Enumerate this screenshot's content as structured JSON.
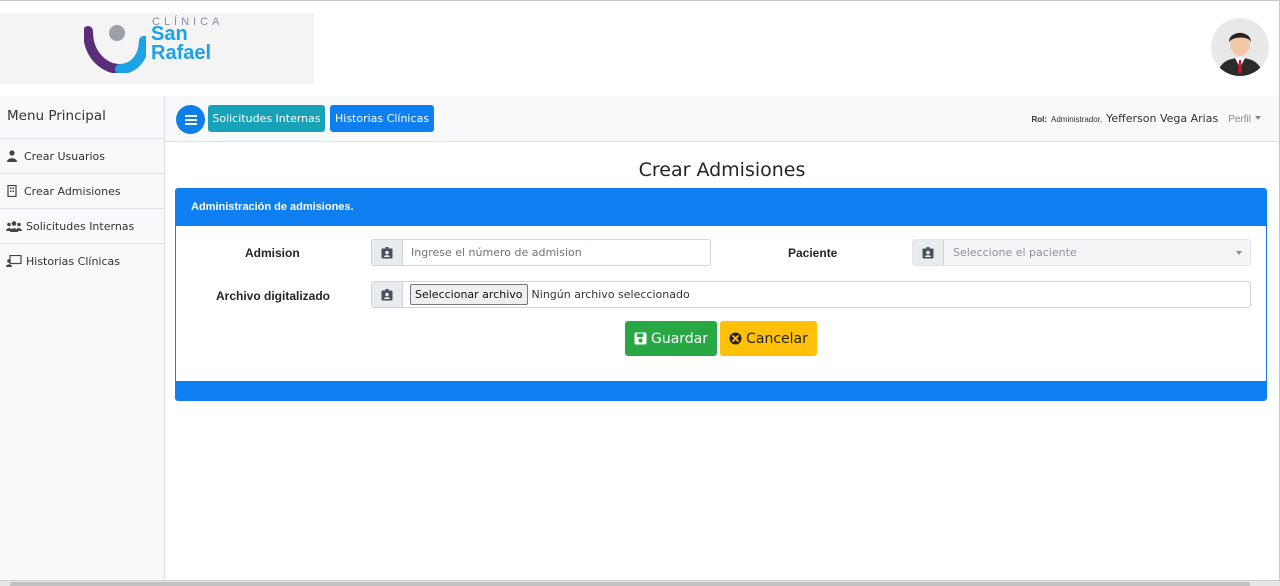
{
  "logo": {
    "small_text": "CLÍNICA",
    "line1": "San",
    "line2": "Rafael"
  },
  "sidebar": {
    "title": "Menu Principal",
    "items": [
      {
        "label": "Crear Usuarios",
        "icon": "user-tie-icon"
      },
      {
        "label": "Crear Admisiones",
        "icon": "building-icon"
      },
      {
        "label": "Solicitudes Internas",
        "icon": "users-icon"
      },
      {
        "label": "Historias Clínicas",
        "icon": "chalkboard-user-icon"
      }
    ]
  },
  "navbar": {
    "btn_solicitudes": "Solicitudes Internas",
    "btn_historias": "Historias Clínicas",
    "rol_label": "Rol:",
    "rol_value": "Administrador,",
    "user_name": "Yefferson Vega Arias",
    "perfil": "Perfil"
  },
  "page": {
    "title": "Crear Admisiones"
  },
  "card": {
    "header": "Administración de admisiones.",
    "admision_label": "Admision",
    "admision_placeholder": "Ingrese el número de admision",
    "paciente_label": "Paciente",
    "paciente_placeholder": "Seleccione el paciente",
    "archivo_label": "Archivo digitalizado",
    "file_button": "Seleccionar archivo",
    "file_status": "Ningún archivo seleccionado",
    "guardar": "Guardar",
    "cancelar": "Cancelar"
  },
  "colors": {
    "primary": "#0d7ff0",
    "info": "#17a2b8",
    "success": "#28a745",
    "warning": "#ffc107"
  }
}
